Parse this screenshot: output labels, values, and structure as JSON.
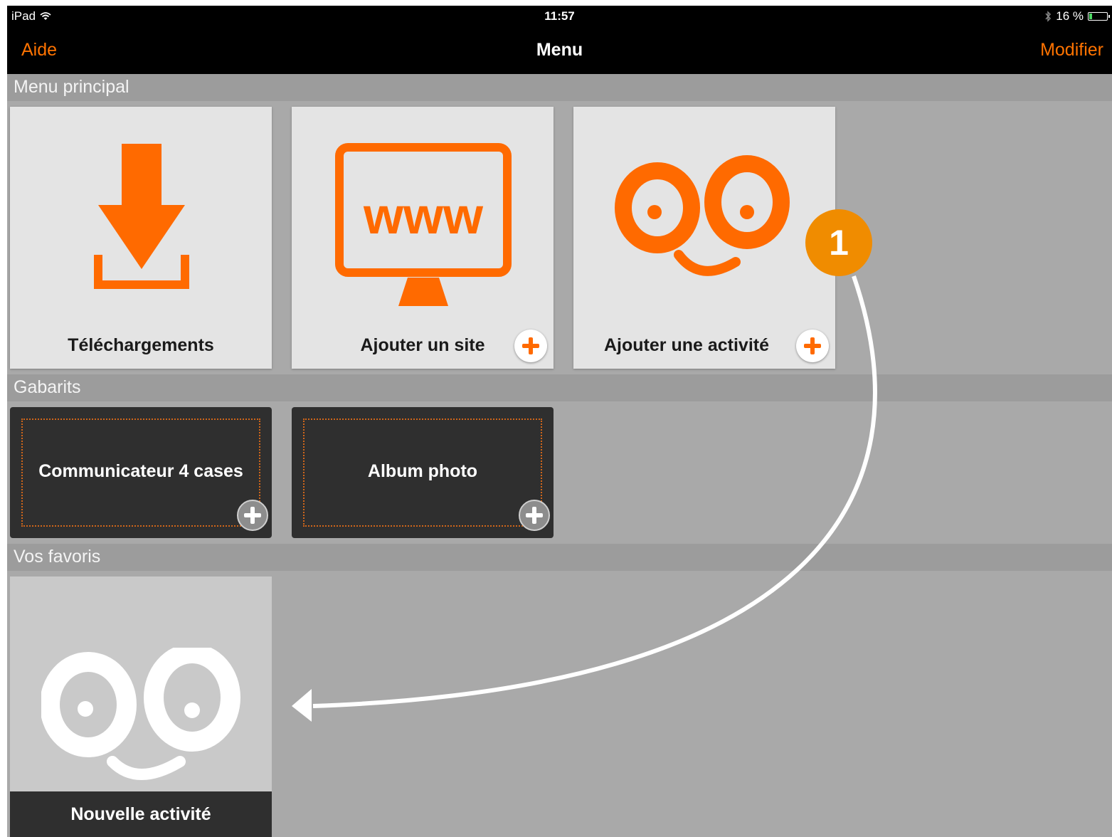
{
  "status_bar": {
    "device": "iPad",
    "time": "11:57",
    "battery": "16 %"
  },
  "nav_bar": {
    "left_button": "Aide",
    "title": "Menu",
    "right_button": "Modifier"
  },
  "sections": {
    "main_menu": {
      "header": "Menu principal",
      "tiles": [
        {
          "label": "Téléchargements",
          "icon": "download-icon"
        },
        {
          "label": "Ajouter un site",
          "icon": "www-monitor-icon"
        },
        {
          "label": "Ajouter une activité",
          "icon": "eyes-face-icon"
        }
      ]
    },
    "templates": {
      "header": "Gabarits",
      "tiles": [
        {
          "label": "Communicateur 4 cases"
        },
        {
          "label": "Album photo"
        }
      ]
    },
    "favorites": {
      "header": "Vos favoris",
      "tiles": [
        {
          "label": "Nouvelle activité",
          "icon": "eyes-face-icon"
        }
      ]
    }
  },
  "annotation": {
    "step_badge": "1"
  },
  "colors": {
    "accent": "#ff7300",
    "icon_orange": "#ff6a00",
    "badge": "#f08c00"
  }
}
